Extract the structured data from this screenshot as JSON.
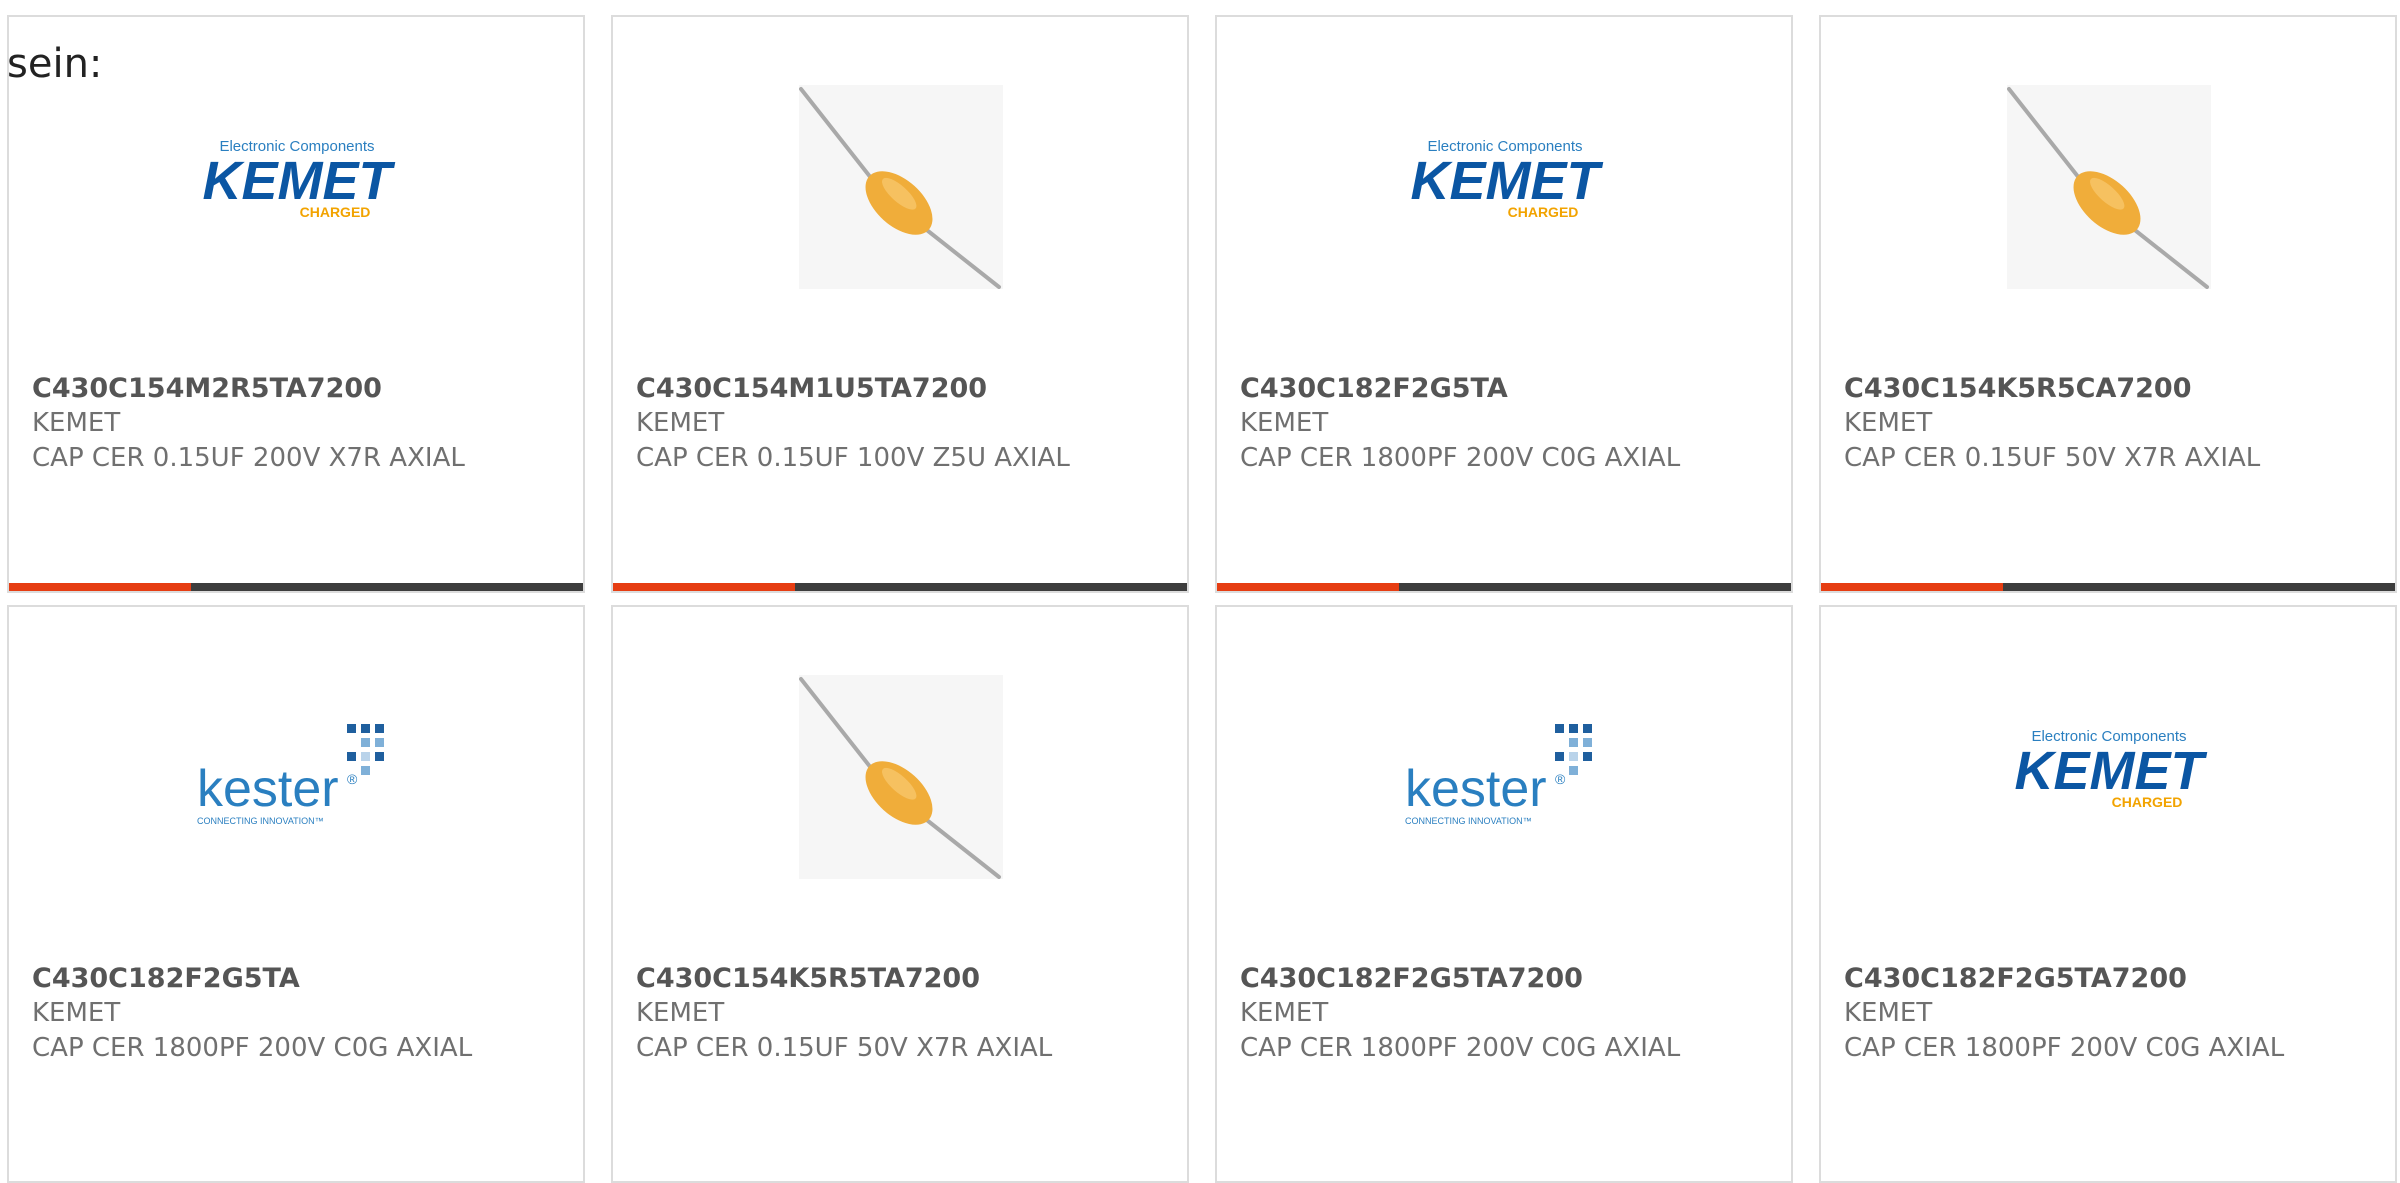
{
  "intro_text": "sein:",
  "colors": {
    "accent": "#e63d12",
    "bar": "#3d3d3d",
    "border": "#dcdcdc",
    "kemet_blue": "#0b56a3",
    "kemet_orange": "#f2a300",
    "kester_blue": "#2a7fc0"
  },
  "logo_text": {
    "kemet": {
      "top": "Electronic Components",
      "main": "KEMET",
      "sub": "CHARGED",
      "mark": "."
    },
    "kester": {
      "main": "kester",
      "reg": "®",
      "sub": "CONNECTING INNOVATION™"
    }
  },
  "products": [
    {
      "image": "kemet-logo",
      "part_number": "C430C154M2R5TA7200",
      "manufacturer": "KEMET",
      "description": "CAP CER 0.15UF 200V X7R AXIAL"
    },
    {
      "image": "capacitor-photo",
      "part_number": "C430C154M1U5TA7200",
      "manufacturer": "KEMET",
      "description": "CAP CER 0.15UF 100V Z5U AXIAL"
    },
    {
      "image": "kemet-logo",
      "part_number": "C430C182F2G5TA",
      "manufacturer": "KEMET",
      "description": "CAP CER 1800PF 200V C0G AXIAL"
    },
    {
      "image": "capacitor-photo",
      "part_number": "C430C154K5R5CA7200",
      "manufacturer": "KEMET",
      "description": "CAP CER 0.15UF 50V X7R AXIAL"
    },
    {
      "image": "kester-logo",
      "part_number": "C430C182F2G5TA",
      "manufacturer": "KEMET",
      "description": "CAP CER 1800PF 200V C0G AXIAL"
    },
    {
      "image": "capacitor-photo",
      "part_number": "C430C154K5R5TA7200",
      "manufacturer": "KEMET",
      "description": "CAP CER 0.15UF 50V X7R AXIAL"
    },
    {
      "image": "kester-logo",
      "part_number": "C430C182F2G5TA7200",
      "manufacturer": "KEMET",
      "description": "CAP CER 1800PF 200V C0G AXIAL"
    },
    {
      "image": "kemet-logo",
      "part_number": "C430C182F2G5TA7200",
      "manufacturer": "KEMET",
      "description": "CAP CER 1800PF 200V C0G AXIAL"
    }
  ]
}
